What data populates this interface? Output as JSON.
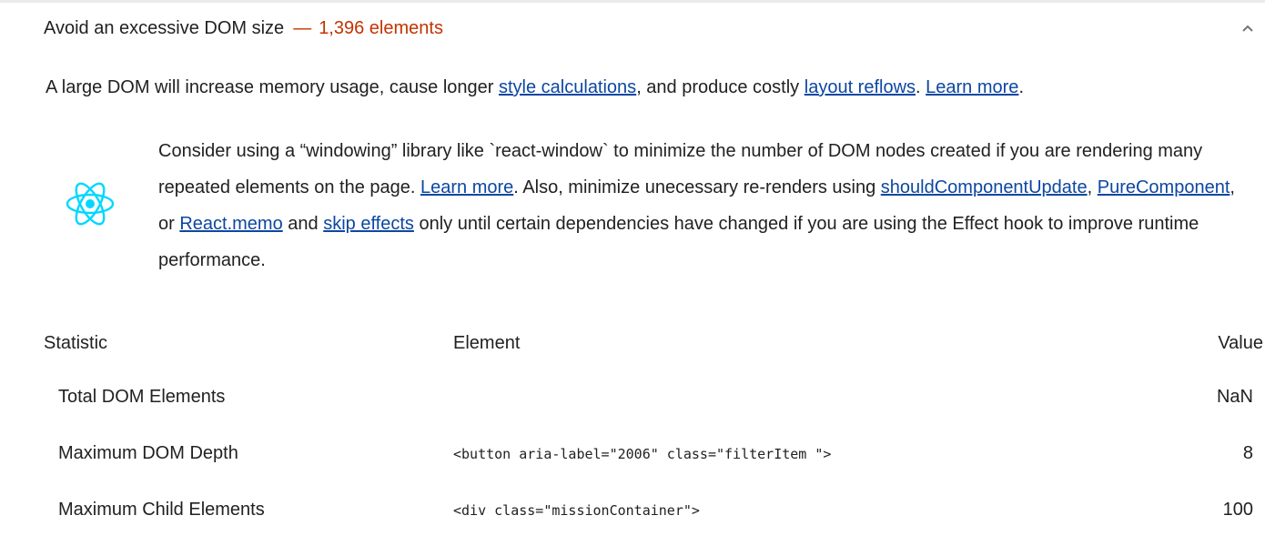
{
  "audit": {
    "title": "Avoid an excessive DOM size",
    "separator": "—",
    "display_value": "1,396 elements",
    "accent_color": "#c33300"
  },
  "description": {
    "part1": "A large DOM will increase memory usage, cause longer ",
    "link1": "style calculations",
    "part2": ", and produce costly ",
    "link2": "layout reflows",
    "part3": ". ",
    "link3": "Learn more",
    "part4": "."
  },
  "stack_pack": {
    "icon": "react-icon",
    "icon_color": "#00d8ff",
    "text1": "Consider using a “windowing” library like `react-window` to minimize the number of DOM nodes created if you are rendering many repeated elements on the page. ",
    "link_learn": "Learn more",
    "text2": ". Also, minimize unecessary re-renders using ",
    "link_scu": "shouldComponentUpdate",
    "text3": ", ",
    "link_pure": "PureComponent",
    "text4": ", or ",
    "link_memo": "React.memo",
    "text5": " and ",
    "link_skip": "skip effects",
    "text6": " only until certain dependencies have changed if you are using the Effect hook to improve runtime performance."
  },
  "table": {
    "headers": [
      "Statistic",
      "Element",
      "Value"
    ],
    "rows": [
      {
        "statistic": "Total DOM Elements",
        "element": "",
        "value": "NaN"
      },
      {
        "statistic": "Maximum DOM Depth",
        "element": "<button aria-label=\"2006\" class=\"filterItem \">",
        "value": "8"
      },
      {
        "statistic": "Maximum Child Elements",
        "element": "<div class=\"missionContainer\">",
        "value": "100"
      }
    ]
  }
}
